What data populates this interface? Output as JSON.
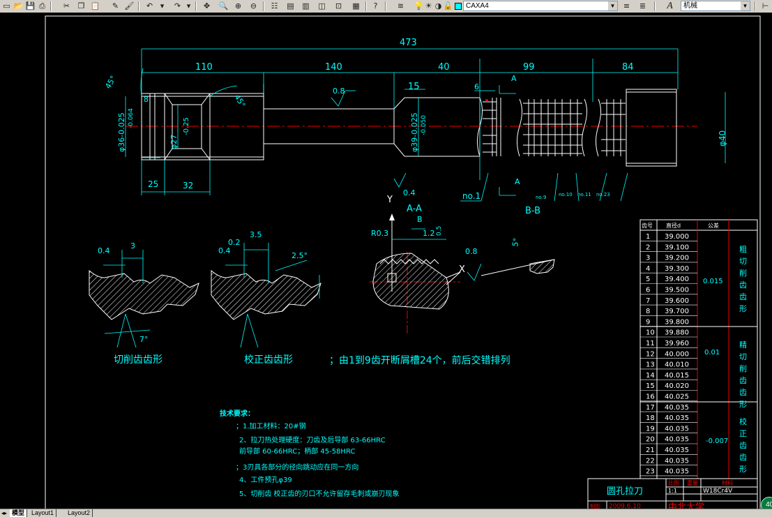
{
  "toolbar": {
    "layer_name": "CAXA4",
    "text_style": "机械",
    "text_style_icon": "A"
  },
  "drawing": {
    "dim_total": "473",
    "dim_110": "110",
    "dim_140": "140",
    "dim_40": "40",
    "dim_99": "99",
    "dim_84": "84",
    "dim_15": "15",
    "dim_6": "6",
    "dim_8": "8",
    "dim_25": "25",
    "dim_32": "32",
    "angle_45a": "45°",
    "angle_45b": "45°",
    "rough_08a": "0.8",
    "rough_04a": "0.4",
    "dia_36": "φ36-0.025",
    "dia_36b": "-0.064",
    "dia_27": "φ27",
    "dia_27tol": "-0.25",
    "dia_39": "φ39-0.025",
    "dia_39b": "-0.050",
    "dia_40": "φ40",
    "section_a_top": "A",
    "section_a_bot": "A",
    "label_no1": "no.1",
    "label_no9": "no.9",
    "label_no10": "no.10",
    "label_no11": "no.11",
    "label_no23": "no.23",
    "label_aa": "A-A",
    "label_bb": "B-B",
    "label_y": "Y",
    "label_x": "X",
    "label_b": "B",
    "label_r03": "R0.3",
    "label_12": "1.2",
    "label_05": "0.5",
    "label_08b": "0.8",
    "label_5deg": "5°",
    "label_04b": "0.4",
    "label_3": "3",
    "label_04c": "0.4",
    "label_02": "0.2",
    "label_35": "3.5",
    "label_25deg": "2.5°",
    "label_7deg": "7°",
    "label_cut": "切削齿齿形",
    "label_cal": "校正齿齿形",
    "label_note": "；由1到9齿开断屑槽24个，前后交错排列",
    "tech_title": "技术要求：",
    "tech_1": "；1.加工材料：20#钢",
    "tech_2": "2、拉刀热处理硬度：刀齿及后导部 63-66HRC",
    "tech_2b": "前导部 60-66HRC；柄部 45-58HRC",
    "tech_3": "；3刃具各部分的径向跳动应在同一方向",
    "tech_4": "4、工件预孔φ39",
    "tech_5": "5、切削齿 校正齿的刃口不允许留存毛刺或崩刃现象"
  },
  "table": {
    "headers": [
      "齿号",
      "直径d",
      "公差"
    ],
    "rows": [
      [
        "1",
        "39.000"
      ],
      [
        "2",
        "39.100"
      ],
      [
        "3",
        "39.200"
      ],
      [
        "4",
        "39.300"
      ],
      [
        "5",
        "39.400"
      ],
      [
        "6",
        "39.500"
      ],
      [
        "7",
        "39.600"
      ],
      [
        "8",
        "39.700"
      ],
      [
        "9",
        "39.800"
      ],
      [
        "10",
        "39.880"
      ],
      [
        "11",
        "39.960"
      ],
      [
        "12",
        "40.000"
      ],
      [
        "13",
        "40.010"
      ],
      [
        "14",
        "40.015"
      ],
      [
        "15",
        "40.020"
      ],
      [
        "16",
        "40.025"
      ],
      [
        "17",
        "40.035"
      ],
      [
        "18",
        "40.035"
      ],
      [
        "19",
        "40.035"
      ],
      [
        "20",
        "40.035"
      ],
      [
        "21",
        "40.035"
      ],
      [
        "22",
        "40.035"
      ],
      [
        "23",
        "40.035"
      ]
    ],
    "tol_1": "0.015",
    "tol_2": "0.01",
    "tol_3": "-0.007",
    "group_1": [
      "粗",
      "切",
      "削",
      "齿",
      "齿",
      "形"
    ],
    "group_2": [
      "精",
      "切",
      "削",
      "齿",
      "齿",
      "形"
    ],
    "group_3": [
      "校",
      "正",
      "齿",
      "齿",
      "形"
    ]
  },
  "title_block": {
    "name": "圆孔拉刀",
    "scale_label": "比例",
    "weight_label": "重量",
    "material_label": "材料",
    "scale": "1:1",
    "material": "W18Cr4V",
    "date_label": "制图",
    "date": "2009.6.10",
    "school": "中北大学"
  },
  "tabs": {
    "model": "模型",
    "layout1": "Layout1",
    "layout2": "Layout2"
  },
  "badge": "40"
}
